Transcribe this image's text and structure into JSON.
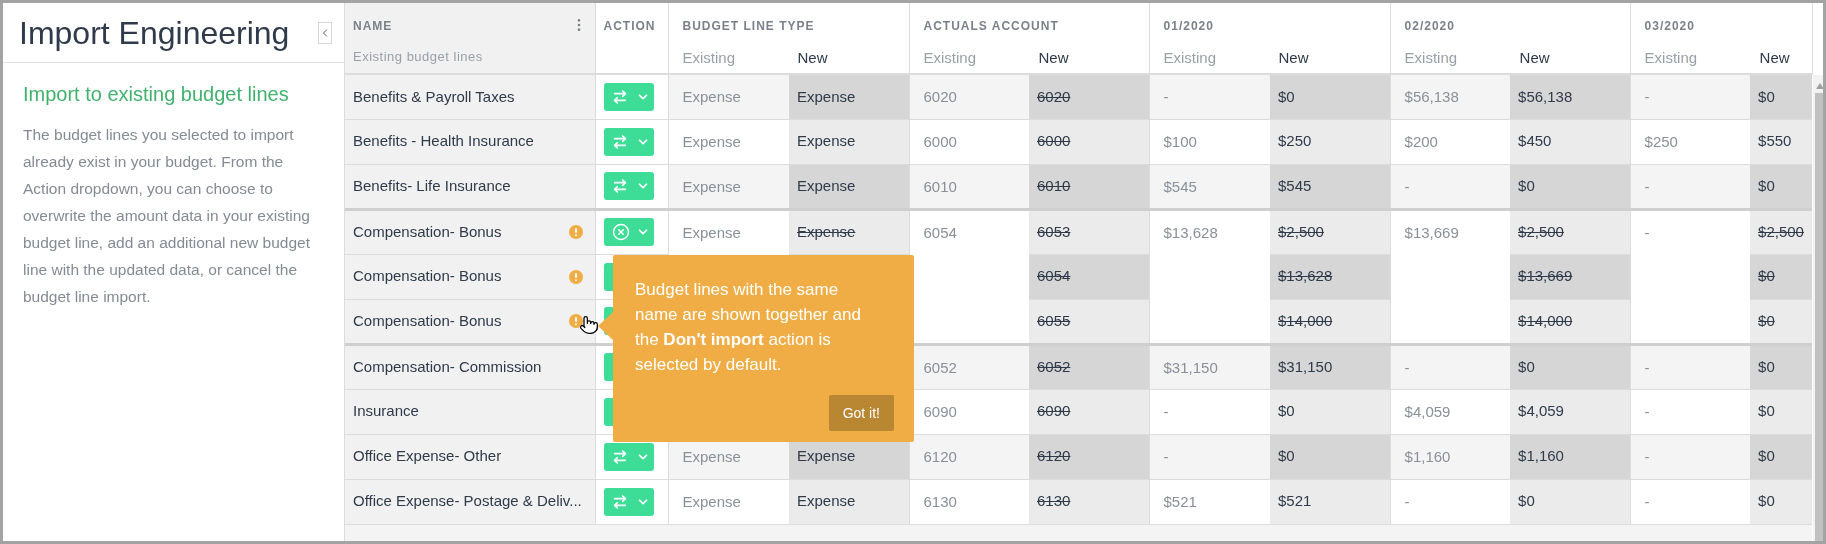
{
  "sidebar": {
    "title": "Import Engineering",
    "heading": "Import to existing budget lines",
    "description": "The budget lines you selected to import already exist in your budget. From the Action dropdown, you can choose to overwrite the amount data in your existing budget line, add an additional new budget line with the updated data, or cancel the budget line import."
  },
  "table": {
    "name_column": {
      "title": "NAME",
      "subtitle": "Existing budget lines"
    },
    "action_column": {
      "title": "ACTION"
    },
    "column_groups": [
      {
        "title": "BUDGET LINE TYPE",
        "existing": "Existing",
        "new": "New"
      },
      {
        "title": "ACTUALS ACCOUNT",
        "existing": "Existing",
        "new": "New"
      },
      {
        "title": "01/2020",
        "existing": "Existing",
        "new": "New"
      },
      {
        "title": "02/2020",
        "existing": "Existing",
        "new": "New"
      },
      {
        "title": "03/2020",
        "existing": "Existing",
        "new": "New"
      }
    ],
    "groups": [
      {
        "existing": {
          "type": "Expense",
          "account": "6020",
          "month_1": "-",
          "month_2": "$56,138",
          "month_3": "-"
        },
        "lines": [
          {
            "name": "Benefits & Payroll Taxes",
            "warning": false,
            "kind": "replace",
            "new": {
              "type": {
                "text": "Expense",
                "struck": false
              },
              "account": {
                "text": "6020",
                "struck": true
              },
              "month_1": {
                "text": "$0",
                "struck": false
              },
              "month_2": {
                "text": "$56,138",
                "struck": false
              },
              "month_3": {
                "text": "$0",
                "struck": false
              }
            }
          }
        ]
      },
      {
        "existing": {
          "type": "Expense",
          "account": "6000",
          "month_1": "$100",
          "month_2": "$200",
          "month_3": "$250"
        },
        "lines": [
          {
            "name": "Benefits - Health Insurance",
            "warning": false,
            "kind": "replace",
            "new": {
              "type": {
                "text": "Expense",
                "struck": false
              },
              "account": {
                "text": "6000",
                "struck": true
              },
              "month_1": {
                "text": "$250",
                "struck": false
              },
              "month_2": {
                "text": "$450",
                "struck": false
              },
              "month_3": {
                "text": "$550",
                "struck": false
              }
            }
          }
        ]
      },
      {
        "existing": {
          "type": "Expense",
          "account": "6010",
          "month_1": "$545",
          "month_2": "-",
          "month_3": "-"
        },
        "lines": [
          {
            "name": "Benefits- Life Insurance",
            "warning": false,
            "kind": "replace",
            "new": {
              "type": {
                "text": "Expense",
                "struck": false
              },
              "account": {
                "text": "6010",
                "struck": true
              },
              "month_1": {
                "text": "$545",
                "struck": false
              },
              "month_2": {
                "text": "$0",
                "struck": false
              },
              "month_3": {
                "text": "$0",
                "struck": false
              }
            }
          }
        ]
      },
      {
        "existing": {
          "type": "Expense",
          "account": "6054",
          "month_1": "$13,628",
          "month_2": "$13,669",
          "month_3": "-"
        },
        "lines": [
          {
            "name": "Compensation- Bonus",
            "warning": true,
            "kind": "dont_import",
            "new": {
              "type": {
                "text": "Expense",
                "struck": true
              },
              "account": {
                "text": "6053",
                "struck": true
              },
              "month_1": {
                "text": "$2,500",
                "struck": true
              },
              "month_2": {
                "text": "$2,500",
                "struck": true
              },
              "month_3": {
                "text": "$2,500",
                "struck": true
              }
            }
          },
          {
            "name": "Compensation- Bonus",
            "warning": true,
            "new": {
              "account": {
                "text": "6054",
                "struck": true
              },
              "month_1": {
                "text": "$13,628",
                "struck": true
              },
              "month_2": {
                "text": "$13,669",
                "struck": true
              },
              "month_3": {
                "text": "$0",
                "struck": true
              }
            }
          },
          {
            "name": "Compensation- Bonus",
            "warning": true,
            "new": {
              "account": {
                "text": "6055",
                "struck": true
              },
              "month_1": {
                "text": "$14,000",
                "struck": true
              },
              "month_2": {
                "text": "$14,000",
                "struck": true
              },
              "month_3": {
                "text": "$0",
                "struck": true
              }
            }
          }
        ]
      },
      {
        "existing": {
          "account": "6052",
          "month_1": "$31,150",
          "month_2": "-",
          "month_3": "-"
        },
        "lines": [
          {
            "name": "Compensation- Commission",
            "warning": false,
            "new": {
              "account": {
                "text": "6052",
                "struck": true
              },
              "month_1": {
                "text": "$31,150",
                "struck": false
              },
              "month_2": {
                "text": "$0",
                "struck": false
              },
              "month_3": {
                "text": "$0",
                "struck": false
              }
            }
          }
        ]
      },
      {
        "existing": {
          "account": "6090",
          "month_1": "-",
          "month_2": "$4,059",
          "month_3": "-"
        },
        "lines": [
          {
            "name": "Insurance",
            "warning": false,
            "new": {
              "account": {
                "text": "6090",
                "struck": true
              },
              "month_1": {
                "text": "$0",
                "struck": false
              },
              "month_2": {
                "text": "$4,059",
                "struck": false
              },
              "month_3": {
                "text": "$0",
                "struck": false
              }
            }
          }
        ]
      },
      {
        "existing": {
          "type": "Expense",
          "account": "6120",
          "month_1": "-",
          "month_2": "$1,160",
          "month_3": "-"
        },
        "lines": [
          {
            "name": "Office Expense- Other",
            "warning": false,
            "kind": "replace",
            "new": {
              "type": {
                "text": "Expense",
                "struck": false
              },
              "account": {
                "text": "6120",
                "struck": true
              },
              "month_1": {
                "text": "$0",
                "struck": false
              },
              "month_2": {
                "text": "$1,160",
                "struck": false
              },
              "month_3": {
                "text": "$0",
                "struck": false
              }
            }
          }
        ]
      },
      {
        "existing": {
          "type": "Expense",
          "account": "6130",
          "month_1": "$521",
          "month_2": "-",
          "month_3": "-"
        },
        "lines": [
          {
            "name": "Office Expense- Postage & Deliv...",
            "warning": false,
            "kind": "replace",
            "new": {
              "type": {
                "text": "Expense",
                "struck": false
              },
              "account": {
                "text": "6130",
                "struck": true
              },
              "month_1": {
                "text": "$521",
                "struck": false
              },
              "month_2": {
                "text": "$0",
                "struck": false
              },
              "month_3": {
                "text": "$0",
                "struck": false
              }
            }
          }
        ]
      }
    ]
  },
  "tooltip": {
    "text": "Budget lines with the same name are shown together and the **Don't import** action is selected by default.",
    "button": "Got it!"
  }
}
